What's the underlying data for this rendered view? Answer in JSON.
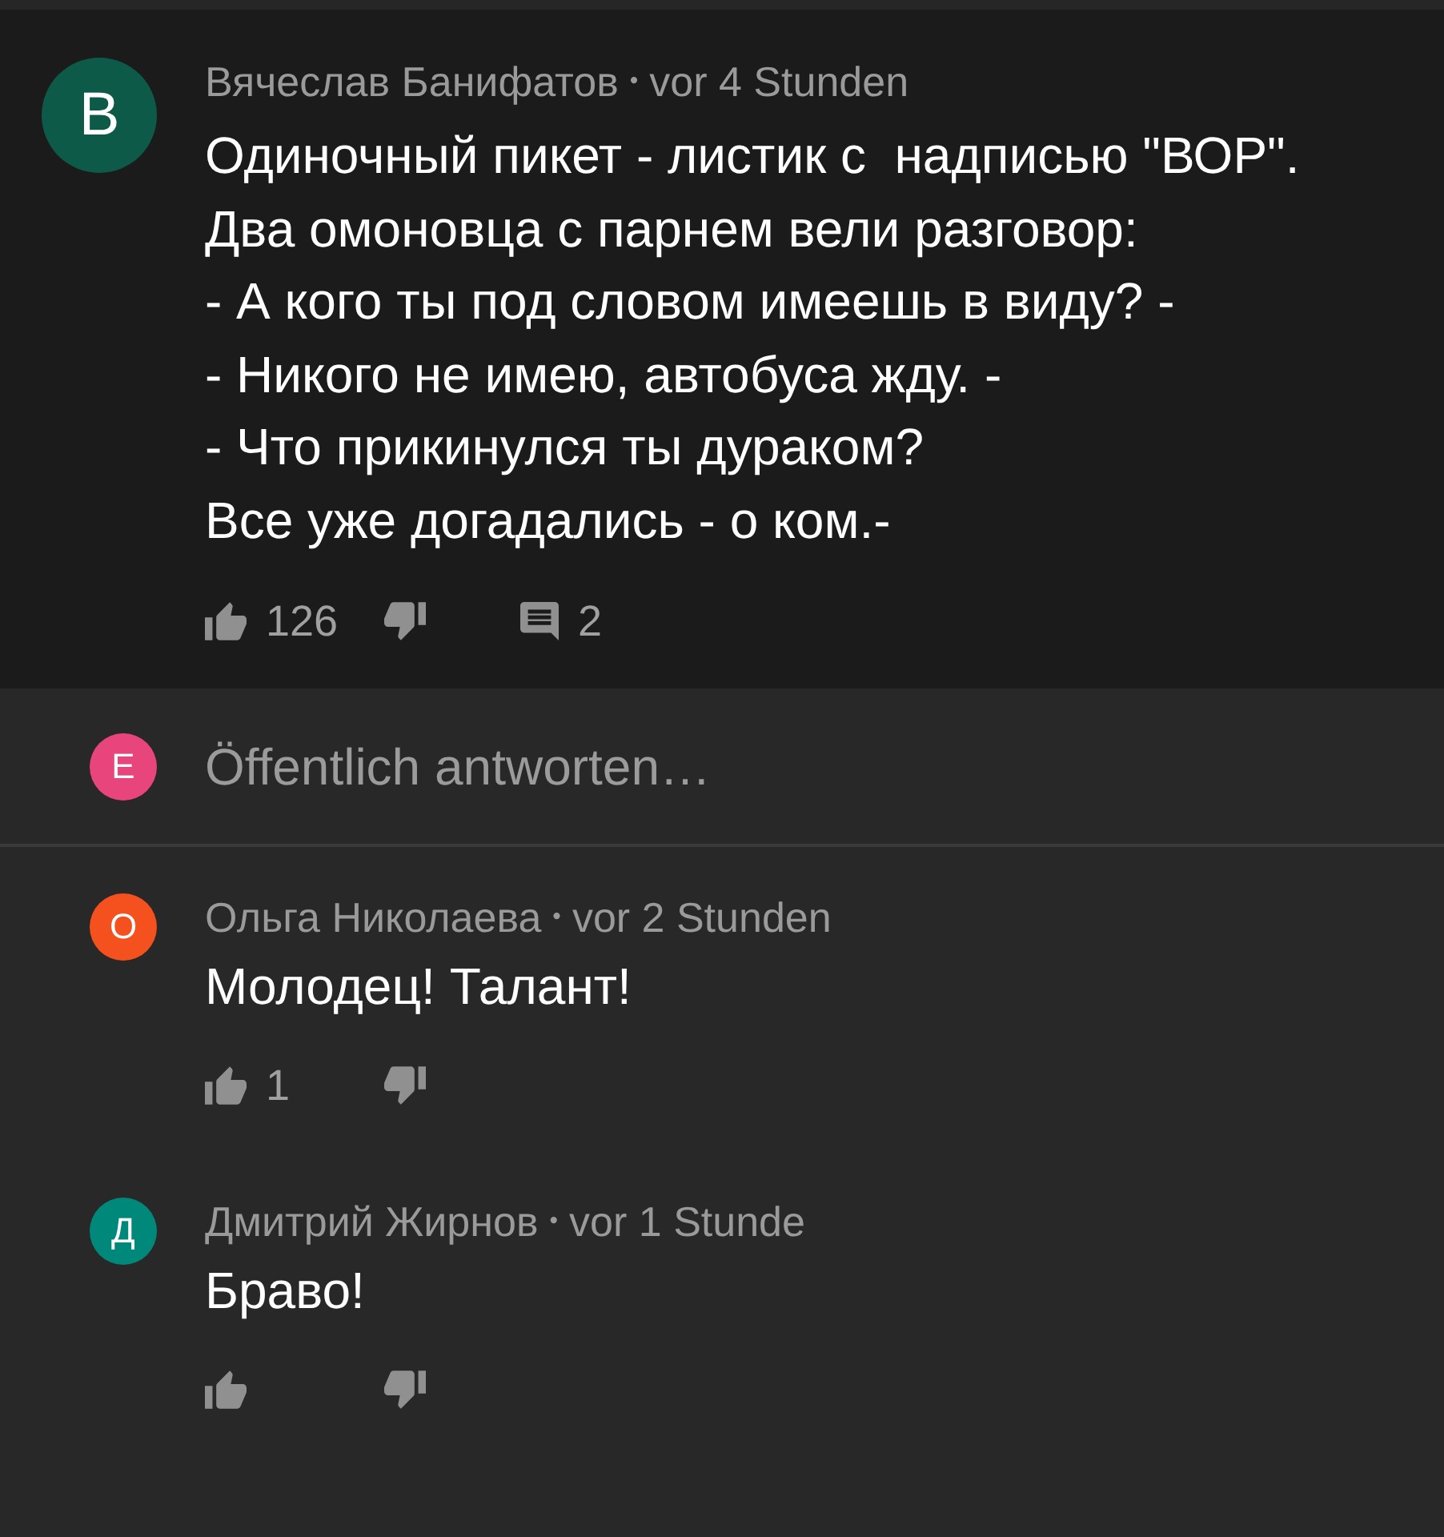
{
  "comment": {
    "avatar_letter": "В",
    "author": "Вячеслав Банифатов",
    "separator": "•",
    "time": "vor 4 Stunden",
    "text": "Одиночный пикет - листик с  надписью \"ВОР\".\nДва омоновца с парнем вели разговор:\n- А кого ты под словом имеешь в виду? -\n- Никого не имею, автобуса жду. -\n- Что прикинулся ты дураком?\nВсе уже догадались - о ком.-",
    "likes": "126",
    "replies": "2"
  },
  "reply_box": {
    "avatar_letter": "E",
    "placeholder": "Öffentlich antworten…"
  },
  "replies": [
    {
      "avatar_letter": "О",
      "color": "#f4511e",
      "author": "Ольга Николаева",
      "separator": "•",
      "time": "vor 2 Stunden",
      "text": "Молодец! Талант!",
      "likes": "1"
    },
    {
      "avatar_letter": "Д",
      "color": "#00897b",
      "author": "Дмитрий Жирнов",
      "separator": "•",
      "time": "vor 1 Stunde",
      "text": "Браво!"
    }
  ]
}
